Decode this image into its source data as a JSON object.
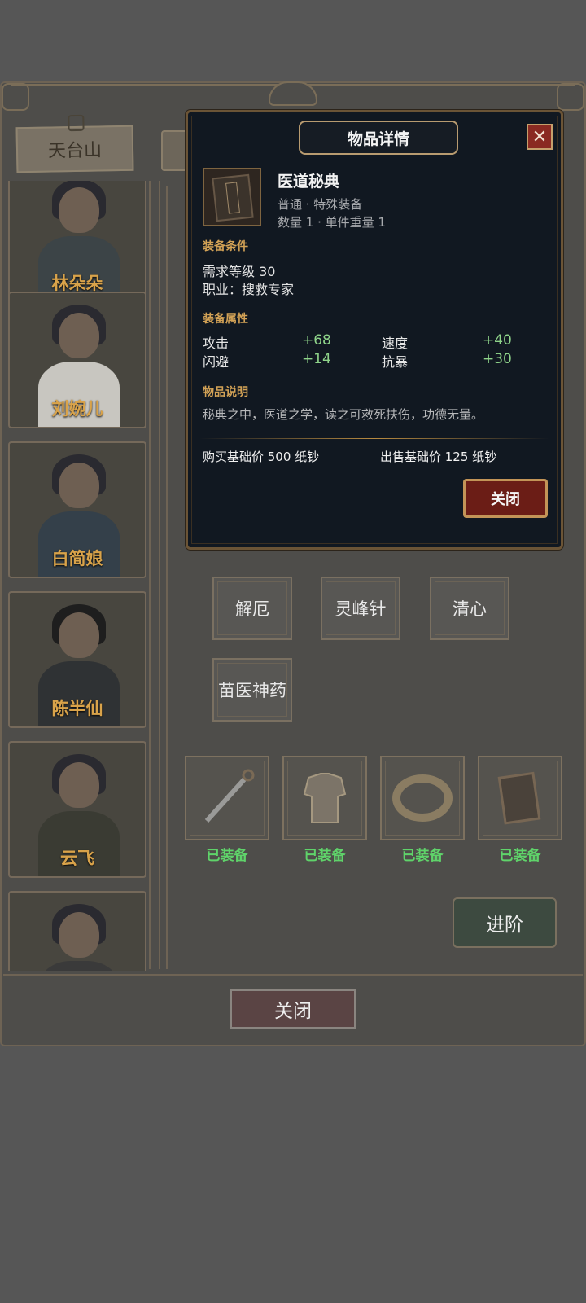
{
  "map_tab": {
    "label": "天台山"
  },
  "characters": [
    {
      "name": "林朵朵"
    },
    {
      "name": "刘婉儿"
    },
    {
      "name": "白简娘"
    },
    {
      "name": "陈半仙"
    },
    {
      "name": "云飞"
    }
  ],
  "skills": [
    "解厄",
    "灵峰针",
    "清心",
    "苗医神药"
  ],
  "equipment": [
    {
      "icon": "dagger-icon",
      "status": "已装备"
    },
    {
      "icon": "armor-icon",
      "status": "已装备"
    },
    {
      "icon": "bracelet-icon",
      "status": "已装备"
    },
    {
      "icon": "book-icon",
      "status": "已装备"
    }
  ],
  "advance_label": "进阶",
  "close_label": "关闭",
  "modal": {
    "title": "物品详情",
    "close_x": "✕",
    "item": {
      "name": "医道秘典",
      "rarity_line": "普通 · 特殊装备",
      "qty_line": "数量 1 · 单件重量 1"
    },
    "req_header": "装备条件",
    "req_level": "需求等级 30",
    "req_job": "职业：搜救专家",
    "attr_header": "装备属性",
    "stats": [
      {
        "label": "攻击",
        "value": "+68"
      },
      {
        "label": "速度",
        "value": "+40"
      },
      {
        "label": "闪避",
        "value": "+14"
      },
      {
        "label": "抗暴",
        "value": "+30"
      }
    ],
    "desc_header": "物品说明",
    "description": "秘典之中，医道之学，读之可救死扶伤，功德无量。",
    "buy_price": "购买基础价 500 纸钞",
    "sell_price": "出售基础价 125 纸钞",
    "close_label": "关闭"
  },
  "colors": {
    "stat_value": "#8fd48a",
    "equipped": "#5fd36a",
    "name_gold": "#d9a34a",
    "section_gold": "#d3a256"
  }
}
